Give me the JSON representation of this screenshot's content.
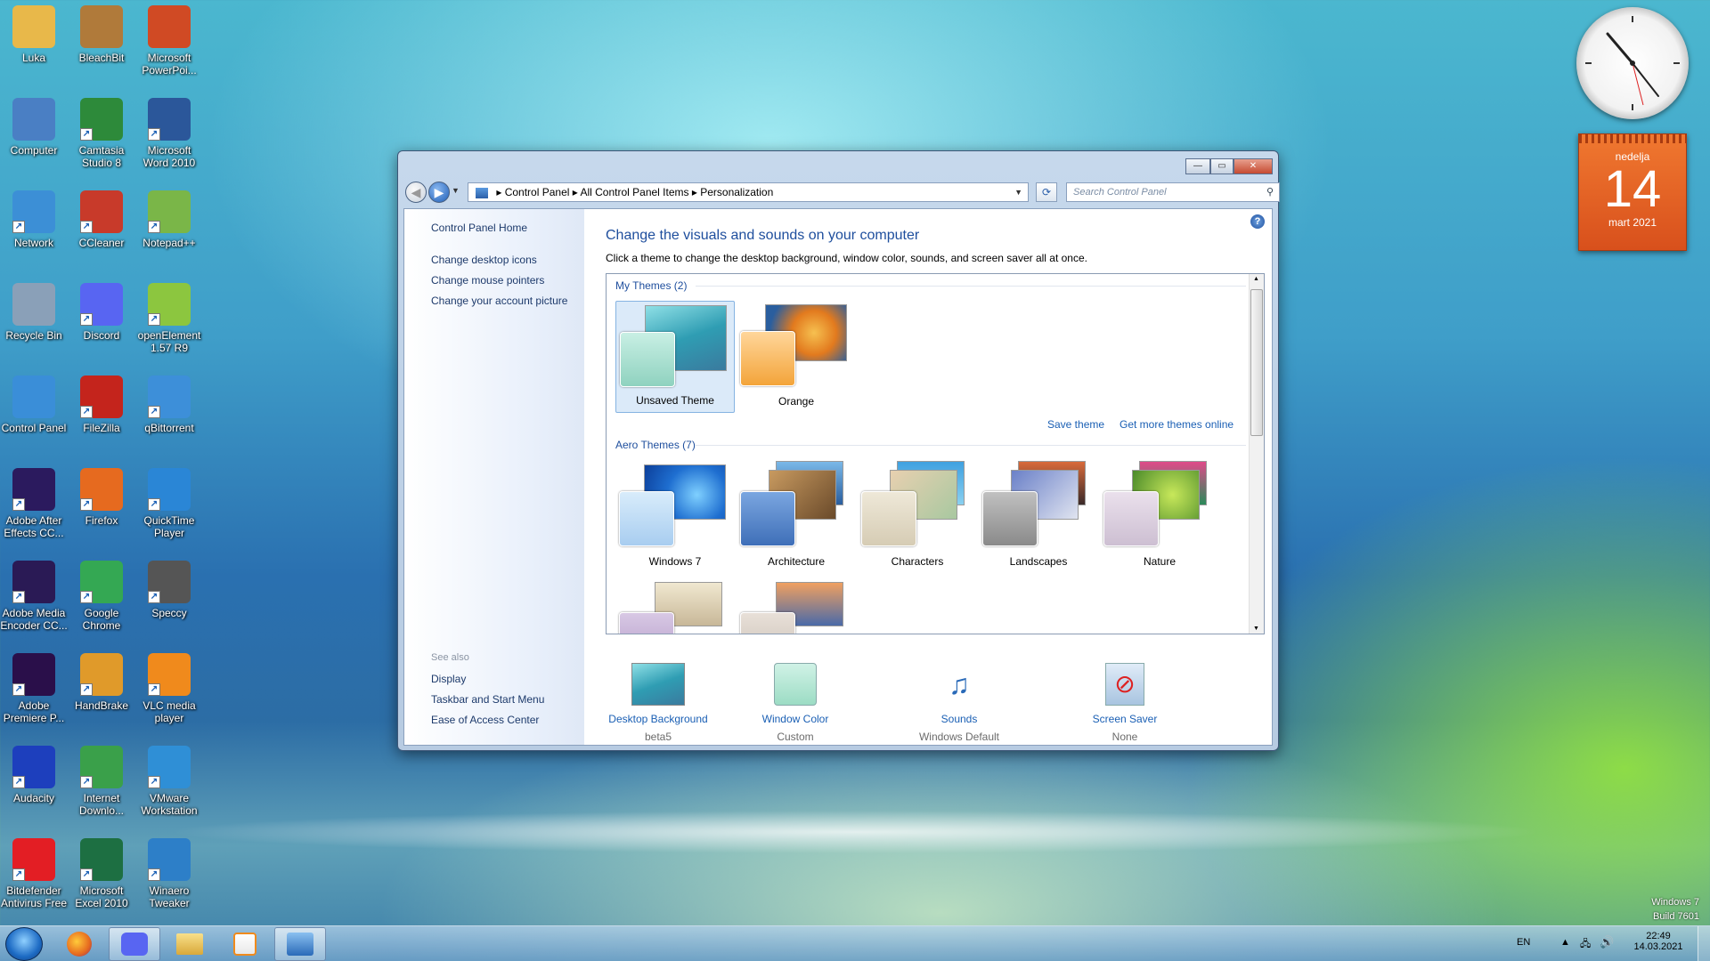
{
  "desktop_icons": [
    {
      "label": "Luka",
      "color": "#e8b84a"
    },
    {
      "label": "BleachBit",
      "color": "#b07a3a"
    },
    {
      "label": "Microsoft PowerPoi...",
      "color": "#d04a24"
    },
    {
      "label": "Computer",
      "color": "#4a7fc4"
    },
    {
      "label": "Camtasia Studio 8",
      "color": "#2d8a3a"
    },
    {
      "label": "Microsoft Word 2010",
      "color": "#2b579a"
    },
    {
      "label": "Network",
      "color": "#3c8fd6"
    },
    {
      "label": "CCleaner",
      "color": "#c83a2a"
    },
    {
      "label": "Notepad++",
      "color": "#7ab648"
    },
    {
      "label": "Recycle Bin",
      "color": "#8aa0b8"
    },
    {
      "label": "Discord",
      "color": "#5865f2"
    },
    {
      "label": "openElement 1.57 R9",
      "color": "#8cc63f"
    },
    {
      "label": "Control Panel",
      "color": "#3a8ed8"
    },
    {
      "label": "FileZilla",
      "color": "#c4241c"
    },
    {
      "label": "qBittorrent",
      "color": "#3d8fd9"
    },
    {
      "label": "Adobe After Effects CC...",
      "color": "#2b1a5e"
    },
    {
      "label": "Firefox",
      "color": "#e66a1f"
    },
    {
      "label": "QuickTime Player",
      "color": "#2a86d6"
    },
    {
      "label": "Adobe Media Encoder CC...",
      "color": "#2a1a55"
    },
    {
      "label": "Google Chrome",
      "color": "#34a853"
    },
    {
      "label": "Speccy",
      "color": "#555555"
    },
    {
      "label": "Adobe Premiere P...",
      "color": "#2a0f4a"
    },
    {
      "label": "HandBrake",
      "color": "#e09a2a"
    },
    {
      "label": "VLC media player",
      "color": "#f08a1c"
    },
    {
      "label": "Audacity",
      "color": "#1d3fbd"
    },
    {
      "label": "Internet Downlo...",
      "color": "#3aa04a"
    },
    {
      "label": "VMware Workstation",
      "color": "#2f8fd6"
    },
    {
      "label": "Bitdefender Antivirus Free",
      "color": "#e31e24"
    },
    {
      "label": "Microsoft Excel 2010",
      "color": "#1d6f42"
    },
    {
      "label": "Winaero Tweaker",
      "color": "#2d7fc8"
    }
  ],
  "gadgets": {
    "calendar": {
      "weekday": "nedelja",
      "day": "14",
      "month": "mart 2021"
    }
  },
  "window": {
    "address": {
      "segments": [
        "Control Panel",
        "All Control Panel Items",
        "Personalization"
      ]
    },
    "search_placeholder": "Search Control Panel",
    "left_pane": {
      "home": "Control Panel Home",
      "links": [
        "Change desktop icons",
        "Change mouse pointers",
        "Change your account picture"
      ],
      "see_also_title": "See also",
      "see_also": [
        "Display",
        "Taskbar and Start Menu",
        "Ease of Access Center"
      ]
    },
    "title": "Change the visuals and sounds on your computer",
    "subtitle": "Click a theme to change the desktop background, window color, sounds, and screen saver all at once.",
    "my_themes": {
      "title": "My Themes (2)",
      "items": [
        "Unsaved Theme",
        "Orange"
      ]
    },
    "save_theme": "Save theme",
    "get_more": "Get more themes online",
    "aero_themes": {
      "title": "Aero Themes (7)",
      "items": [
        "Windows 7",
        "Architecture",
        "Characters",
        "Landscapes",
        "Nature"
      ]
    },
    "bottom": [
      {
        "label": "Desktop Background",
        "value": "beta5"
      },
      {
        "label": "Window Color",
        "value": "Custom"
      },
      {
        "label": "Sounds",
        "value": "Windows Default"
      },
      {
        "label": "Screen Saver",
        "value": "None"
      }
    ]
  },
  "taskbar": {
    "lang": "EN",
    "time": "22:49",
    "date": "14.03.2021"
  },
  "watermark": {
    "line1": "Windows 7",
    "line2": "Build 7601"
  }
}
